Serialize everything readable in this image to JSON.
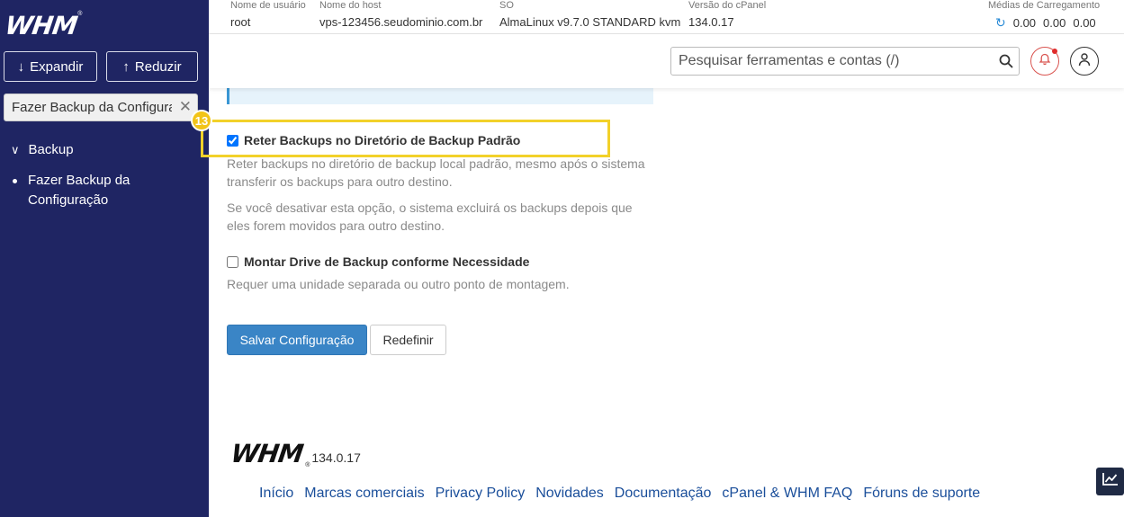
{
  "sidebar": {
    "logo": "WHM",
    "expand_label": "Expandir",
    "reduce_label": "Reduzir",
    "search_value": "Fazer Backup da Configurac",
    "category": "Backup",
    "items": [
      {
        "label": "Fazer Backup da Configuração"
      }
    ]
  },
  "header": {
    "username_label": "Nome de usuário",
    "username": "root",
    "hostname_label": "Nome do host",
    "hostname": "vps-123456.seudominio.com.br",
    "os_label": "SO",
    "os": "AlmaLinux v9.7.0 STANDARD kvm",
    "cpanel_version_label": "Versão do cPanel",
    "cpanel_version": "134.0.17",
    "load_label": "Médias de Carregamento",
    "load_values": [
      "0.00",
      "0.00",
      "0.00"
    ]
  },
  "toolbar": {
    "search_placeholder": "Pesquisar ferramentas e contas (/)"
  },
  "main": {
    "step_badge": "13",
    "option1": {
      "label": "Reter Backups no Diretório de Backup Padrão",
      "checked": true,
      "description1": "Reter backups no diretório de backup local padrão, mesmo após o sistema transferir os backups para outro destino.",
      "description2": "Se você desativar esta opção, o sistema excluirá os backups depois que eles forem movidos para outro destino."
    },
    "option2": {
      "label": "Montar Drive de Backup conforme Necessidade",
      "checked": false,
      "description": "Requer uma unidade separada ou outro ponto de montagem."
    },
    "save_label": "Salvar Configuração",
    "reset_label": "Redefinir"
  },
  "footer": {
    "logo": "WHM",
    "version": "134.0.17",
    "links": [
      "Início",
      "Marcas comerciais",
      "Privacy Policy",
      "Novidades",
      "Documentação",
      "cPanel & WHM FAQ",
      "Fóruns de suporte"
    ]
  },
  "colors": {
    "sidebar_bg": "#1f2563",
    "accent": "#3a85c6",
    "highlight": "#f2d12a",
    "link": "#1a4e9a"
  }
}
